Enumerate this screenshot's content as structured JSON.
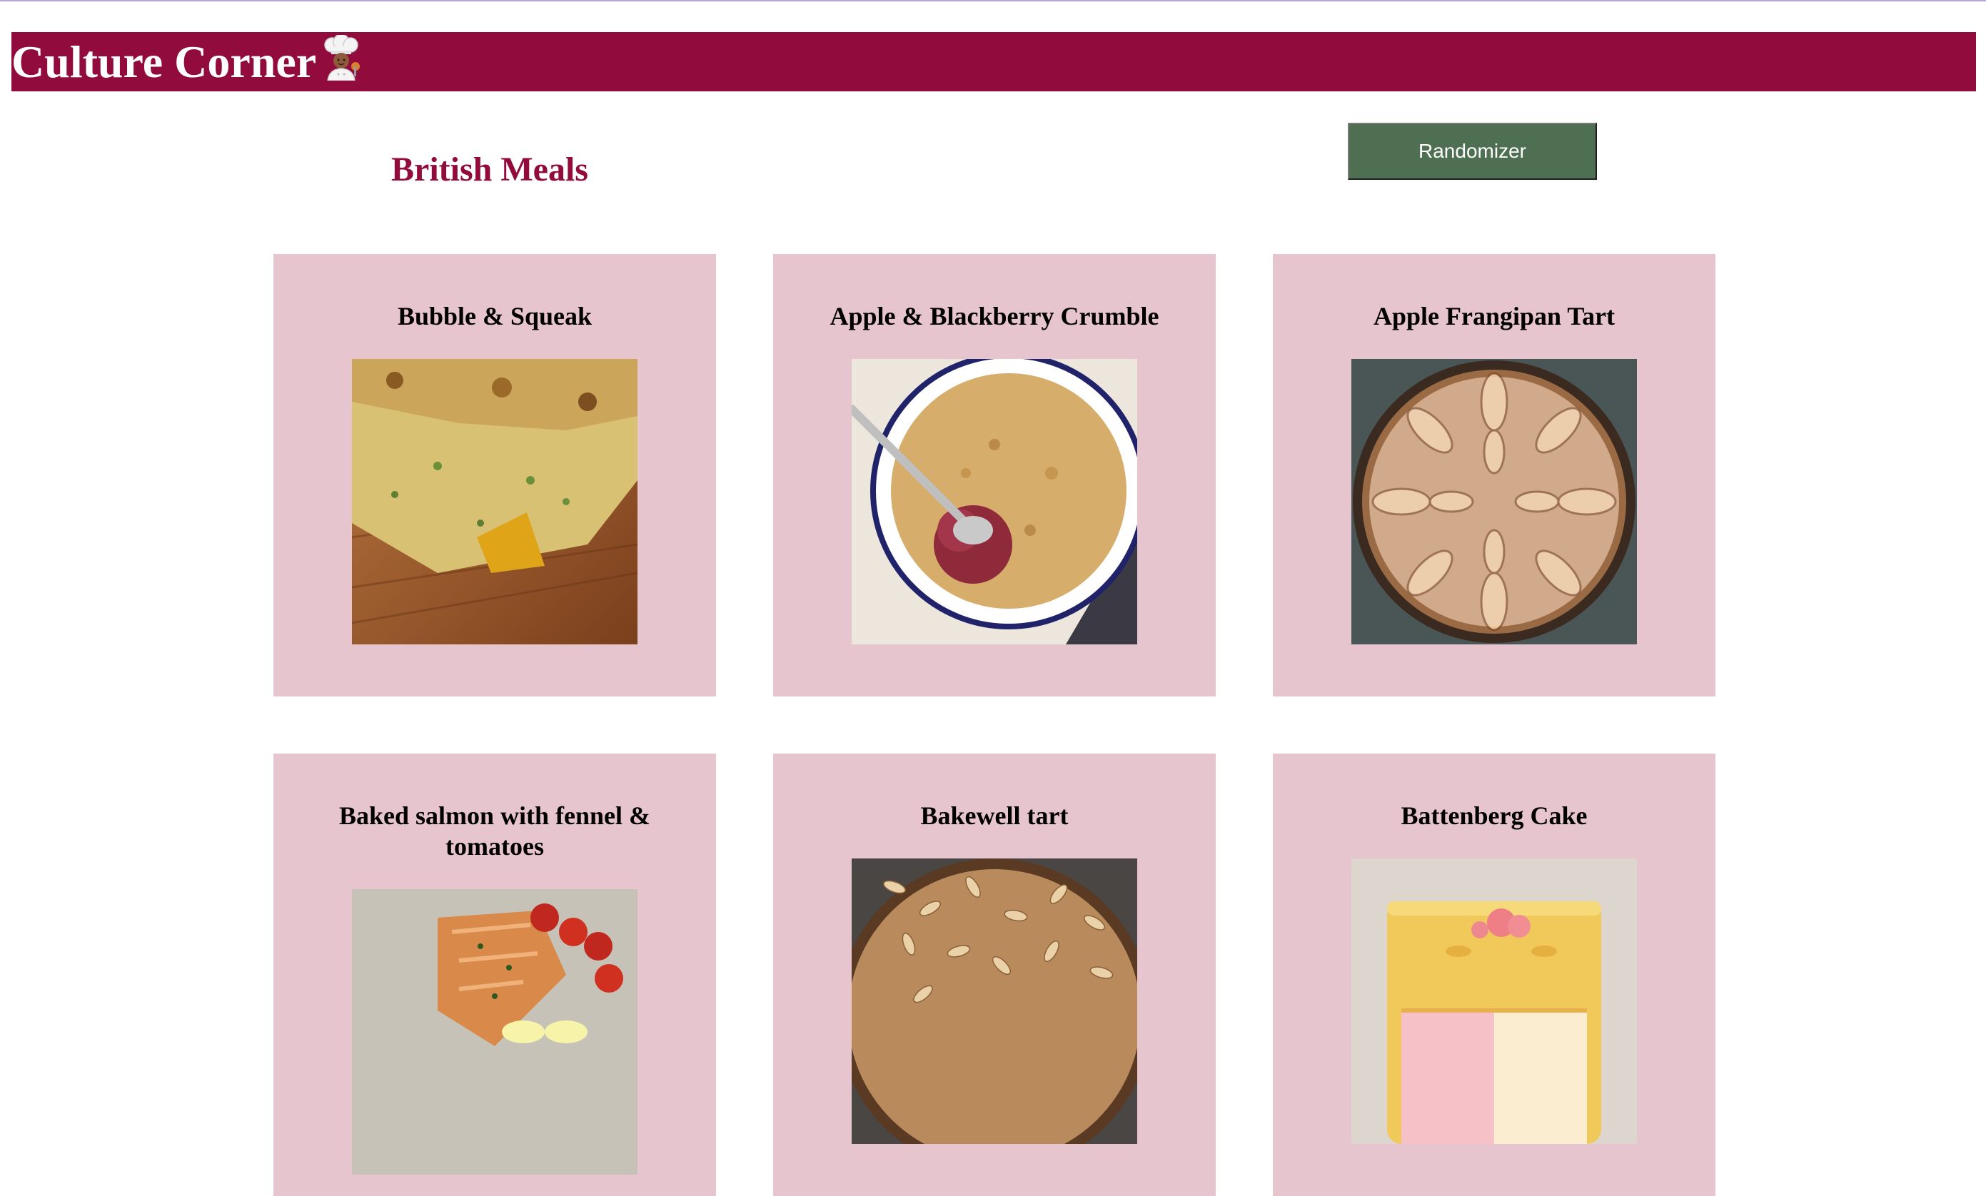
{
  "header": {
    "title": "Culture Corner",
    "icon": "chef-icon",
    "background_color": "#910c3c"
  },
  "main": {
    "heading": "British Meals",
    "randomizer_label": "Randomizer",
    "button_color": "#4f6f52",
    "card_color": "#e7c5cf"
  },
  "meals": [
    {
      "title": "Bubble & Squeak",
      "image": "bubble-squeak-photo"
    },
    {
      "title": "Apple & Blackberry Crumble",
      "image": "apple-blackberry-crumble-photo"
    },
    {
      "title": "Apple Frangipan Tart",
      "image": "apple-frangipan-tart-photo"
    },
    {
      "title": "Baked salmon with fennel & tomatoes",
      "image": "baked-salmon-photo"
    },
    {
      "title": "Bakewell tart",
      "image": "bakewell-tart-photo"
    },
    {
      "title": "Battenberg Cake",
      "image": "battenberg-cake-photo"
    }
  ]
}
